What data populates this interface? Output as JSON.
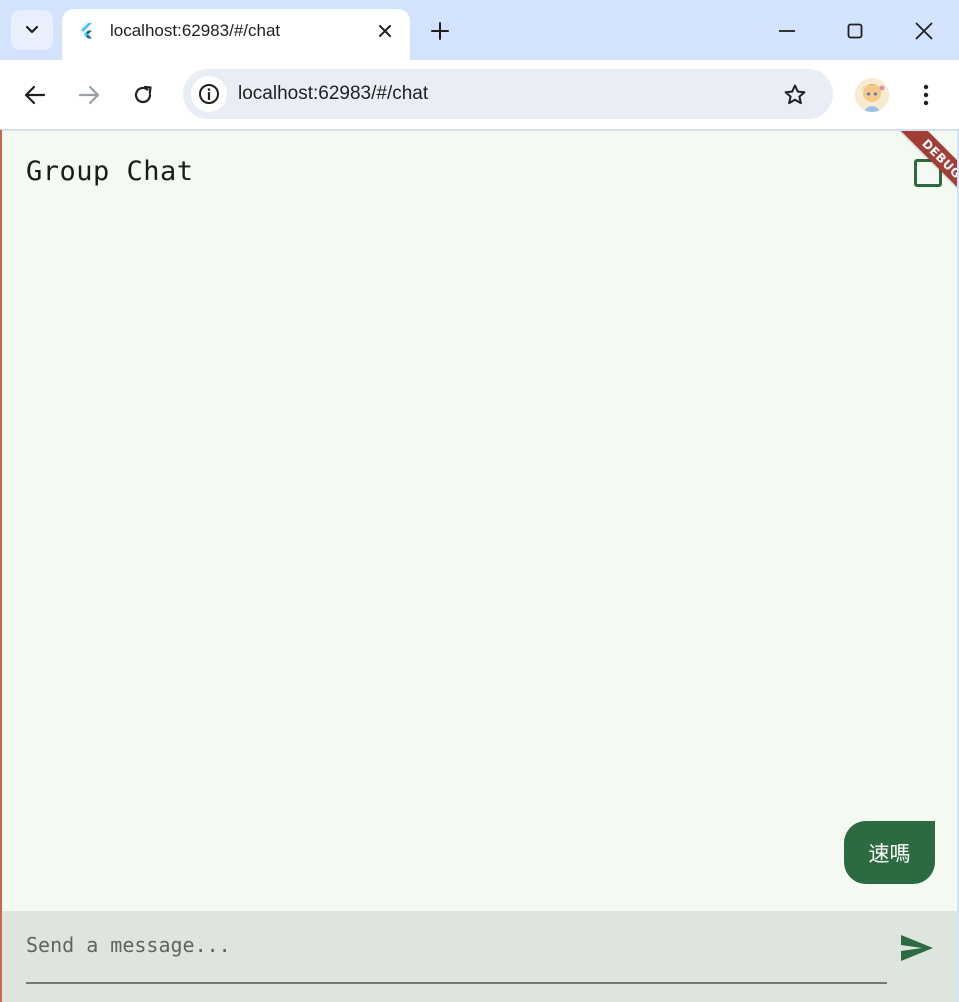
{
  "browser": {
    "tab": {
      "title": "localhost:62983/#/chat",
      "favicon": "flutter-icon"
    },
    "omnibox": {
      "url": "localhost:62983/#/chat"
    }
  },
  "app": {
    "title": "Group Chat",
    "debug_banner": "DEBUG",
    "messages": [
      {
        "text": "速嗎",
        "own": true
      }
    ],
    "composer": {
      "placeholder": "Send a message...",
      "value": ""
    }
  },
  "colors": {
    "accent": "#2c6a41",
    "background": "#f4f9f1",
    "composer_bg": "#dde5dc",
    "debug": "#a23e38"
  }
}
